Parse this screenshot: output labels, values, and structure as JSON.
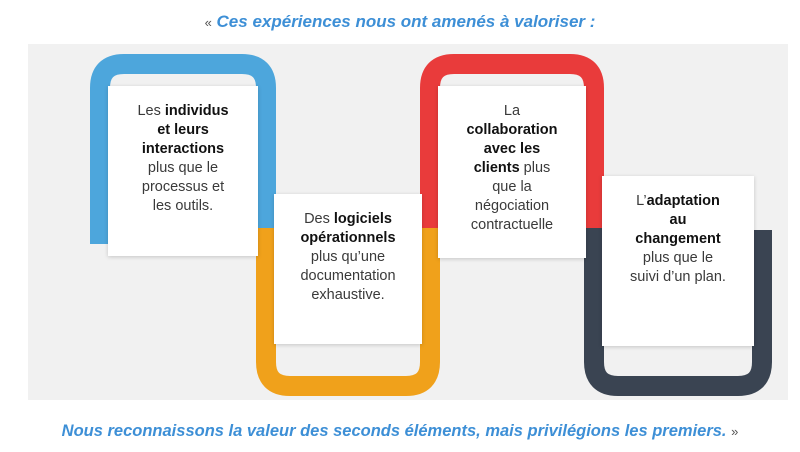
{
  "header": {
    "open_quote": "«",
    "text": "Ces expériences nous ont amenés à valoriser :"
  },
  "footer": {
    "text": "Nous reconnaissons la valeur des seconds éléments, mais privilégions les premiers.",
    "close_quote": "»"
  },
  "colors": {
    "blue": "#4da6dc",
    "orange": "#f0a11b",
    "red": "#e93b3b",
    "dark": "#3a4452",
    "accent_text": "#3d8fd6"
  },
  "values": [
    {
      "lines": [
        {
          "parts": [
            {
              "t": "Les ",
              "b": false
            },
            {
              "t": "individus",
              "b": true
            }
          ]
        },
        {
          "parts": [
            {
              "t": "et leurs",
              "b": true
            }
          ]
        },
        {
          "parts": [
            {
              "t": "interactions",
              "b": true
            }
          ]
        },
        {
          "parts": [
            {
              "t": "plus que le",
              "b": false
            }
          ]
        },
        {
          "parts": [
            {
              "t": "processus et",
              "b": false
            }
          ]
        },
        {
          "parts": [
            {
              "t": "les outils.",
              "b": false
            }
          ]
        }
      ]
    },
    {
      "lines": [
        {
          "parts": [
            {
              "t": "Des ",
              "b": false
            },
            {
              "t": "logiciels",
              "b": true
            }
          ]
        },
        {
          "parts": [
            {
              "t": "opérationnels",
              "b": true
            }
          ]
        },
        {
          "parts": [
            {
              "t": "plus qu’une",
              "b": false
            }
          ]
        },
        {
          "parts": [
            {
              "t": "documentation",
              "b": false
            }
          ]
        },
        {
          "parts": [
            {
              "t": "exhaustive.",
              "b": false
            }
          ]
        }
      ]
    },
    {
      "lines": [
        {
          "parts": [
            {
              "t": "La",
              "b": false
            }
          ]
        },
        {
          "parts": [
            {
              "t": "collaboration",
              "b": true
            }
          ]
        },
        {
          "parts": [
            {
              "t": "avec les",
              "b": true
            }
          ]
        },
        {
          "parts": [
            {
              "t": "clients",
              "b": true
            },
            {
              "t": " plus",
              "b": false
            }
          ]
        },
        {
          "parts": [
            {
              "t": "que la",
              "b": false
            }
          ]
        },
        {
          "parts": [
            {
              "t": "négociation",
              "b": false
            }
          ]
        },
        {
          "parts": [
            {
              "t": "contractuelle",
              "b": false
            }
          ]
        }
      ]
    },
    {
      "lines": [
        {
          "parts": [
            {
              "t": "L’",
              "b": false
            },
            {
              "t": "adaptation",
              "b": true
            }
          ]
        },
        {
          "parts": [
            {
              "t": "au",
              "b": true
            }
          ]
        },
        {
          "parts": [
            {
              "t": "changement",
              "b": true
            }
          ]
        },
        {
          "parts": [
            {
              "t": "plus que le",
              "b": false
            }
          ]
        },
        {
          "parts": [
            {
              "t": "suivi d’un plan.",
              "b": false
            }
          ]
        }
      ]
    }
  ]
}
